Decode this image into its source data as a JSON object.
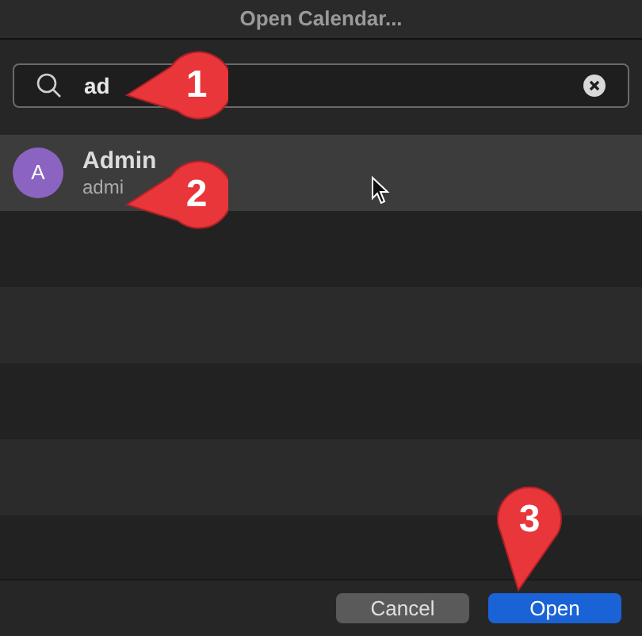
{
  "window": {
    "title": "Open Calendar..."
  },
  "search": {
    "value": "ad"
  },
  "results": [
    {
      "initial": "A",
      "name": "Admin",
      "subtitle": "admi",
      "selected": true
    }
  ],
  "buttons": [
    {
      "label": "Cancel",
      "kind": "secondary"
    },
    {
      "label": "Open",
      "kind": "primary"
    }
  ],
  "callouts": [
    {
      "label": "1"
    },
    {
      "label": "2"
    },
    {
      "label": "3"
    }
  ]
}
